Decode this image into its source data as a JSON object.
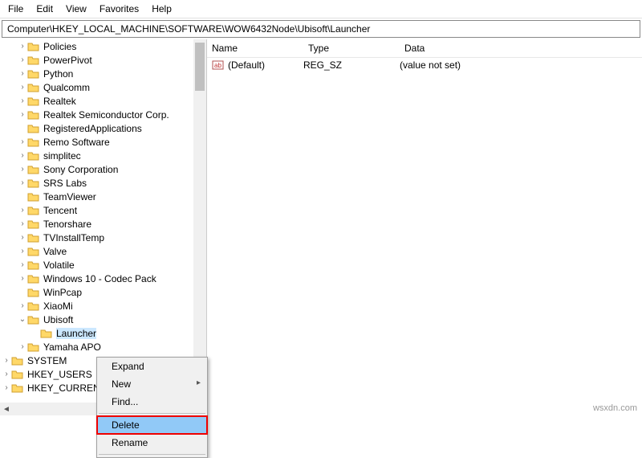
{
  "menubar": {
    "file": "File",
    "edit": "Edit",
    "view": "View",
    "favorites": "Favorites",
    "help": "Help"
  },
  "address": "Computer\\HKEY_LOCAL_MACHINE\\SOFTWARE\\WOW6432Node\\Ubisoft\\Launcher",
  "tree_items": [
    {
      "label": "Policies",
      "indent": 1,
      "twisty": ">"
    },
    {
      "label": "PowerPivot",
      "indent": 1,
      "twisty": ">"
    },
    {
      "label": "Python",
      "indent": 1,
      "twisty": ">"
    },
    {
      "label": "Qualcomm",
      "indent": 1,
      "twisty": ">"
    },
    {
      "label": "Realtek",
      "indent": 1,
      "twisty": ">"
    },
    {
      "label": "Realtek Semiconductor Corp.",
      "indent": 1,
      "twisty": ">"
    },
    {
      "label": "RegisteredApplications",
      "indent": 1,
      "twisty": ""
    },
    {
      "label": "Remo Software",
      "indent": 1,
      "twisty": ">"
    },
    {
      "label": "simplitec",
      "indent": 1,
      "twisty": ">"
    },
    {
      "label": "Sony Corporation",
      "indent": 1,
      "twisty": ">"
    },
    {
      "label": "SRS Labs",
      "indent": 1,
      "twisty": ">"
    },
    {
      "label": "TeamViewer",
      "indent": 1,
      "twisty": ""
    },
    {
      "label": "Tencent",
      "indent": 1,
      "twisty": ">"
    },
    {
      "label": "Tenorshare",
      "indent": 1,
      "twisty": ">"
    },
    {
      "label": "TVInstallTemp",
      "indent": 1,
      "twisty": ">"
    },
    {
      "label": "Valve",
      "indent": 1,
      "twisty": ">"
    },
    {
      "label": "Volatile",
      "indent": 1,
      "twisty": ">"
    },
    {
      "label": "Windows 10 - Codec Pack",
      "indent": 1,
      "twisty": ">"
    },
    {
      "label": "WinPcap",
      "indent": 1,
      "twisty": ""
    },
    {
      "label": "XiaoMi",
      "indent": 1,
      "twisty": ">"
    },
    {
      "label": "Ubisoft",
      "indent": 1,
      "twisty": "v"
    },
    {
      "label": "Launcher",
      "indent": 2,
      "twisty": "",
      "selected": true
    },
    {
      "label": "Yamaha APO",
      "indent": 1,
      "twisty": ">"
    }
  ],
  "root_items": [
    {
      "label": "SYSTEM",
      "indent": 0,
      "twisty": ">"
    },
    {
      "label": "HKEY_USERS",
      "indent": 0,
      "twisty": ">"
    },
    {
      "label": "HKEY_CURRENT_CON",
      "indent": 0,
      "twisty": ">"
    }
  ],
  "value_headers": {
    "name": "Name",
    "type": "Type",
    "data": "Data"
  },
  "value_row": {
    "name": "(Default)",
    "type": "REG_SZ",
    "data": "(value not set)"
  },
  "context_menu": {
    "expand": "Expand",
    "new": "New",
    "find": "Find...",
    "delete": "Delete",
    "rename": "Rename"
  },
  "watermark": "wsxdn.com"
}
